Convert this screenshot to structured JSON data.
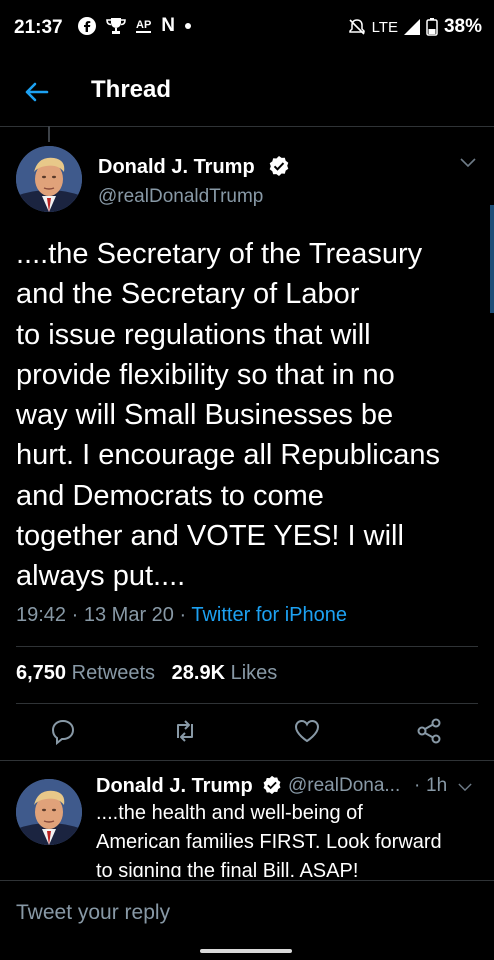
{
  "status_bar": {
    "time": "21:37",
    "left_icons": [
      "facebook-icon",
      "trophy-icon",
      "ap-icon",
      "netflix-icon",
      "dot-icon"
    ],
    "ap_text": "AP",
    "n_text": "N",
    "right_icons": [
      "mute-icon",
      "lte-signal-icon",
      "battery-icon"
    ],
    "network": "LTE",
    "battery": "38%"
  },
  "header": {
    "title": "Thread",
    "back_icon": "arrow-left-icon"
  },
  "tweet": {
    "author_name": "Donald J. Trump",
    "verified": true,
    "handle": "@realDonaldTrump",
    "text_lines": [
      "....the Secretary of the Treasury",
      "and the Secretary of Labor",
      "to issue regulations that will",
      "provide flexibility so that in no",
      "way will Small Businesses be",
      "hurt. I encourage all Republicans",
      "and Democrats to come",
      "together and VOTE YES! I will",
      "always put...."
    ],
    "time": "19:42",
    "date": "13 Mar 20",
    "separator": "·",
    "source": "Twitter for iPhone",
    "retweets_count": "6,750",
    "retweets_label": "Retweets",
    "likes_count": "28.9K",
    "likes_label": "Likes"
  },
  "reply": {
    "author_name": "Donald J. Trump",
    "handle": "@realDona...",
    "separator": "·",
    "time_ago": "1h",
    "text_lines": [
      "....the health and well-being of",
      "American families FIRST. Look forward",
      "to signing the final Bill, ASAP!"
    ]
  },
  "compose": {
    "placeholder": "Tweet your reply"
  },
  "colors": {
    "accent": "#1da1f2",
    "muted": "#8899a6",
    "background": "#000000",
    "divider": "#2f3336"
  }
}
